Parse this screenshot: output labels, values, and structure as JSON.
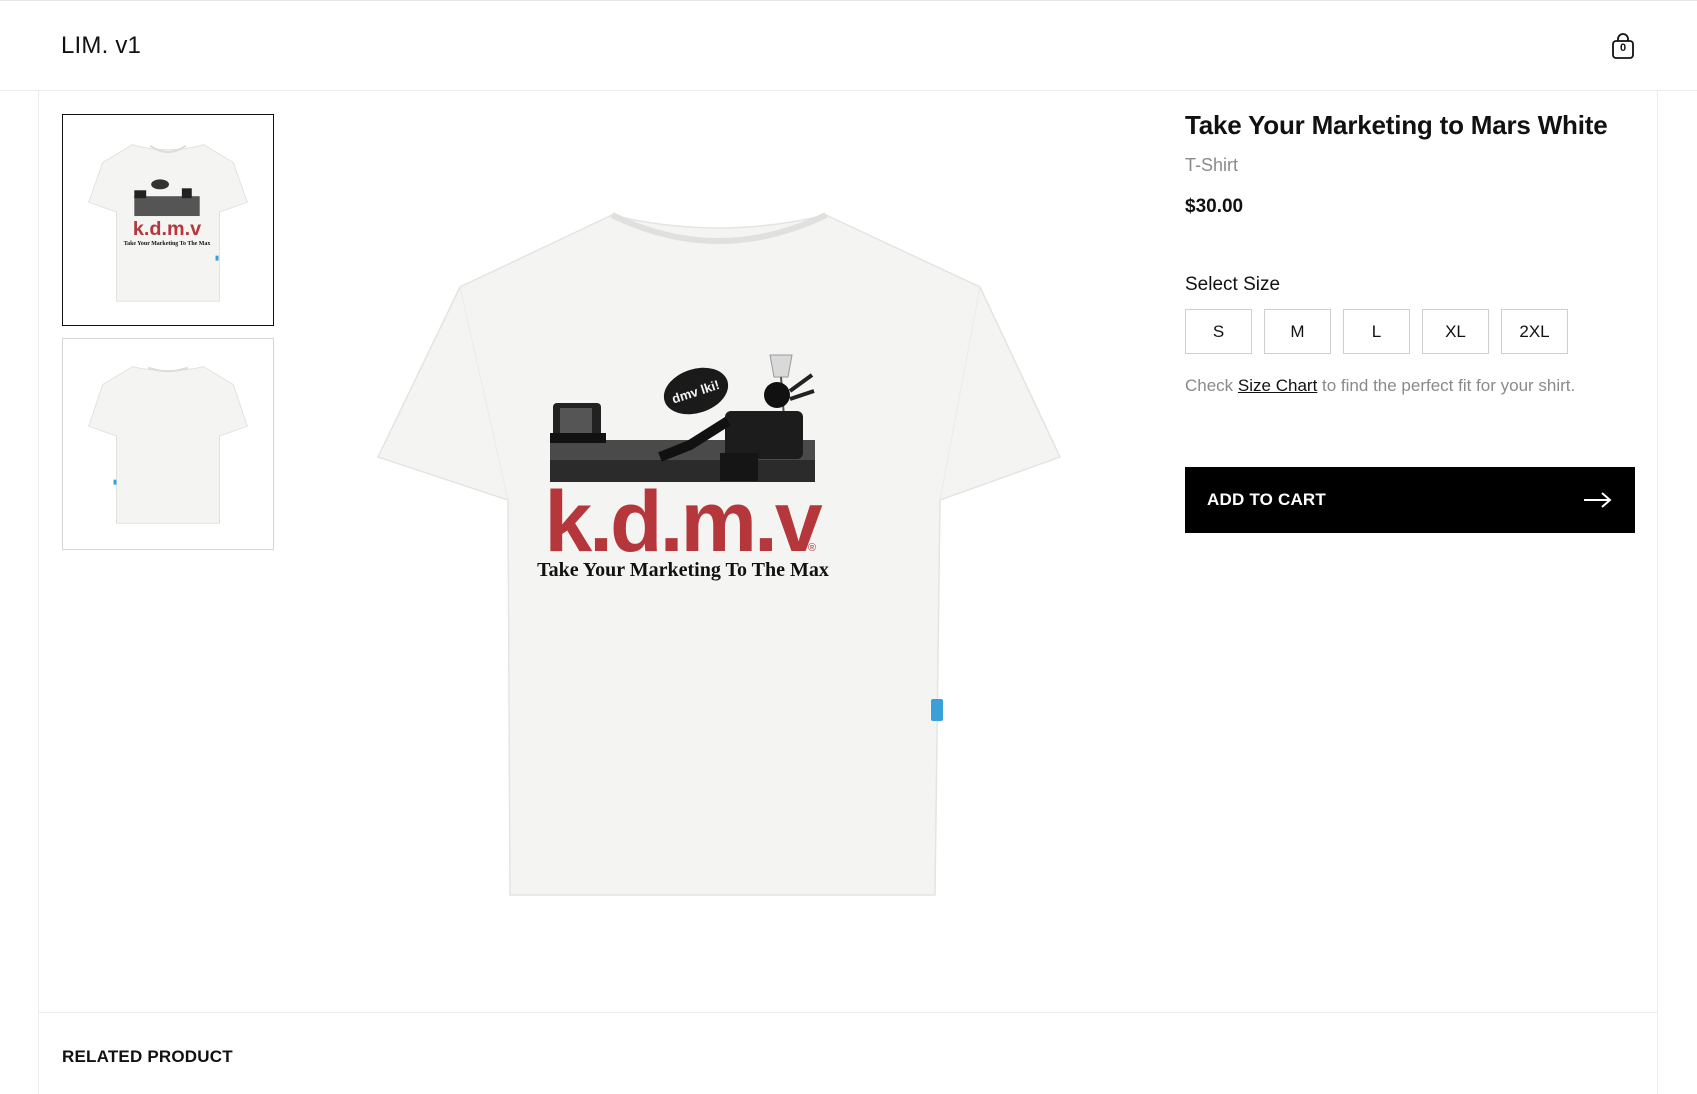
{
  "header": {
    "logo": "LIM. v1",
    "cart_count": "0"
  },
  "gallery": {
    "thumbnails": [
      {
        "label": "front",
        "active": true
      },
      {
        "label": "back",
        "active": false
      }
    ],
    "print": {
      "brand_text": "k.d.m.v",
      "tagline": "Take Your Marketing To The Max",
      "bubble_text": "dmv lki!"
    }
  },
  "product": {
    "title": "Take Your Marketing to Mars White",
    "category": "T-Shirt",
    "price": "$30.00",
    "size_label": "Select Size",
    "sizes": [
      "S",
      "M",
      "L",
      "XL",
      "2XL"
    ],
    "size_help_prefix": "Check",
    "size_chart_link": "Size Chart",
    "size_help_suffix": "to find the perfect fit for your shirt.",
    "add_to_cart": "ADD TO CART"
  },
  "related": {
    "heading": "RELATED PRODUCT"
  },
  "colors": {
    "brand_red": "#b5373b",
    "button_bg": "#000000",
    "shirt": "#f4f4f2"
  }
}
